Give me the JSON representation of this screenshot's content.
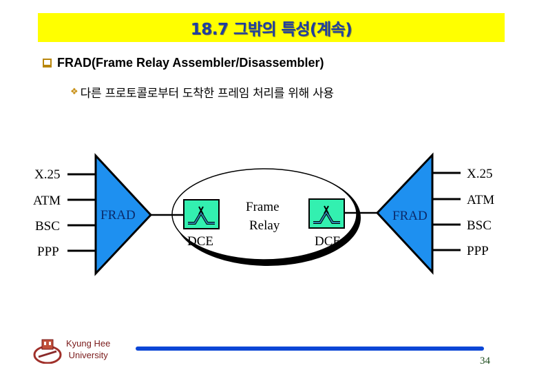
{
  "slide": {
    "title": "18.7 그밖의 특성(계속)",
    "bullet_main": "FRAD(Frame Relay Assembler/Disassembler)",
    "bullet_sub": "다른 프로토콜로부터 도착한 프레임 처리를 위해 사용",
    "bullet_main_icon": "square-bullet-icon",
    "bullet_sub_icon": "diamond-bullet-icon",
    "colors": {
      "title_bg": "#ffff00",
      "title_text": "#1f3fa0",
      "frad_fill": "#1e90f0",
      "dce_fill": "#33f0b0",
      "footer_bar": "#0b46d6"
    }
  },
  "diagram": {
    "left_protocols": [
      "X.25",
      "ATM",
      "BSC",
      "PPP"
    ],
    "right_protocols": [
      "X.25",
      "ATM",
      "BSC",
      "PPP"
    ],
    "left_device": "FRAD",
    "right_device": "FRAD",
    "network_label_line1": "Frame",
    "network_label_line2": "Relay",
    "left_switch": "DCE",
    "right_switch": "DCE"
  },
  "footer": {
    "university_line1": "Kyung Hee",
    "university_line2": "University",
    "page_number": "34"
  }
}
